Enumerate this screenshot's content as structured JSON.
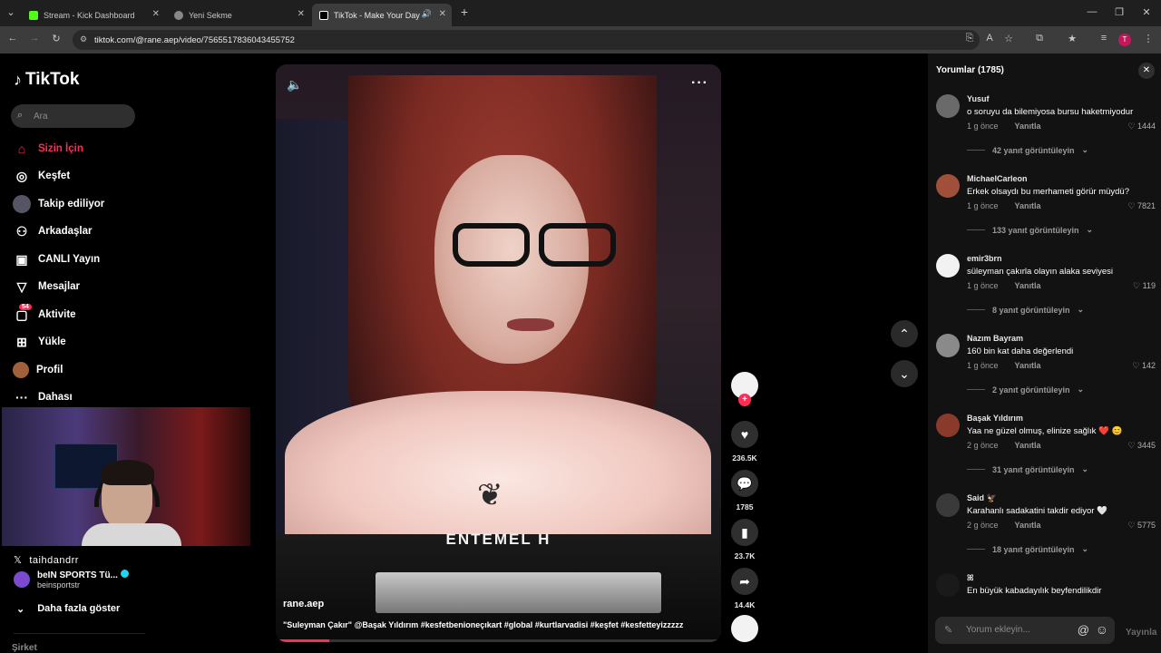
{
  "browser": {
    "tabs": [
      {
        "title": "Stream - Kick Dashboard"
      },
      {
        "title": "Yeni Sekme"
      },
      {
        "title": "TikTok - Make Your Day"
      }
    ],
    "url": "tiktok.com/@rane.aep/video/7565517836043455752"
  },
  "sidebar": {
    "logo": "TikTok",
    "search_placeholder": "Ara",
    "items": [
      {
        "label": "Sizin İçin",
        "icon": "home-icon"
      },
      {
        "label": "Keşfet",
        "icon": "compass-icon"
      },
      {
        "label": "Takip ediliyor",
        "icon": "following-icon"
      },
      {
        "label": "Arkadaşlar",
        "icon": "friends-icon"
      },
      {
        "label": "CANLI Yayın",
        "icon": "live-icon"
      },
      {
        "label": "Mesajlar",
        "icon": "messages-icon"
      },
      {
        "label": "Aktivite",
        "icon": "activity-icon",
        "badge": "54"
      },
      {
        "label": "Yükle",
        "icon": "upload-icon"
      },
      {
        "label": "Profil",
        "icon": "profile-icon"
      },
      {
        "label": "Dahası",
        "icon": "more-icon"
      }
    ],
    "stream_handle": "taihdandrr",
    "following": {
      "name": "beIN SPORTS Tü...",
      "handle": "beinsportstr"
    },
    "more_label": "Daha fazla göster",
    "company": "Şirket"
  },
  "video": {
    "overlay_text": "ENTEMEL H",
    "author": "rane.aep",
    "description": "\"Suleyman Çakır\" @Başak Yıldırım  #kesfetbenioneçıkart #global #kurtlarvadisi #keşfet #kesfetteyizzzzz",
    "progress": 0.12
  },
  "actions": {
    "likes": "236.5K",
    "comments": "1785",
    "saves": "23.7K",
    "shares": "14.4K"
  },
  "comments_panel": {
    "title": "Yorumlar (1785)",
    "comments": [
      {
        "user": "Yusuf",
        "text": "o soruyu da bilemiyosa bursu haketmiyodur",
        "time": "1 g önce",
        "reply": "Yanıtla",
        "likes": "1444",
        "more": "42 yanıt görüntüleyin",
        "avatar_color": "#6a6a6a"
      },
      {
        "user": "MichaelCarleon",
        "text": "Erkek olsaydı bu merhameti görür müydü?",
        "time": "1 g önce",
        "reply": "Yanıtla",
        "likes": "7821",
        "more": "133 yanıt görüntüleyin",
        "avatar_color": "#a0503a"
      },
      {
        "user": "emir3brn",
        "text": "süleyman çakırla olayın alaka seviyesi",
        "time": "1 g önce",
        "reply": "Yanıtla",
        "likes": "119",
        "more": "8 yanıt görüntüleyin",
        "avatar_color": "#f2f2f2"
      },
      {
        "user": "Nazım Bayram",
        "text": "160 bin kat daha değerlendi",
        "time": "1 g önce",
        "reply": "Yanıtla",
        "likes": "142",
        "more": "2 yanıt görüntüleyin",
        "avatar_color": "#8a8a8a"
      },
      {
        "user": "Başak Yıldırım",
        "text": "Yaa ne güzel olmuş, elinize sağlık ❤️ 😊",
        "time": "2 g önce",
        "reply": "Yanıtla",
        "likes": "3445",
        "more": "31 yanıt görüntüleyin",
        "avatar_color": "#8a3a2a"
      },
      {
        "user": "Said 🦅",
        "text": "Karahanlı sadakatini takdir ediyor 🤍",
        "time": "2 g önce",
        "reply": "Yanıtla",
        "likes": "5775",
        "more": "18 yanıt görüntüleyin",
        "avatar_color": "#3a3a3a"
      },
      {
        "user": "ꕤ",
        "text": "En büyük kabadayılık beyfendilikdir",
        "time": "",
        "reply": "",
        "likes": "",
        "more": "",
        "avatar_color": "#1a1a1a"
      }
    ],
    "input_placeholder": "Yorum ekleyin...",
    "post_label": "Yayınla"
  }
}
